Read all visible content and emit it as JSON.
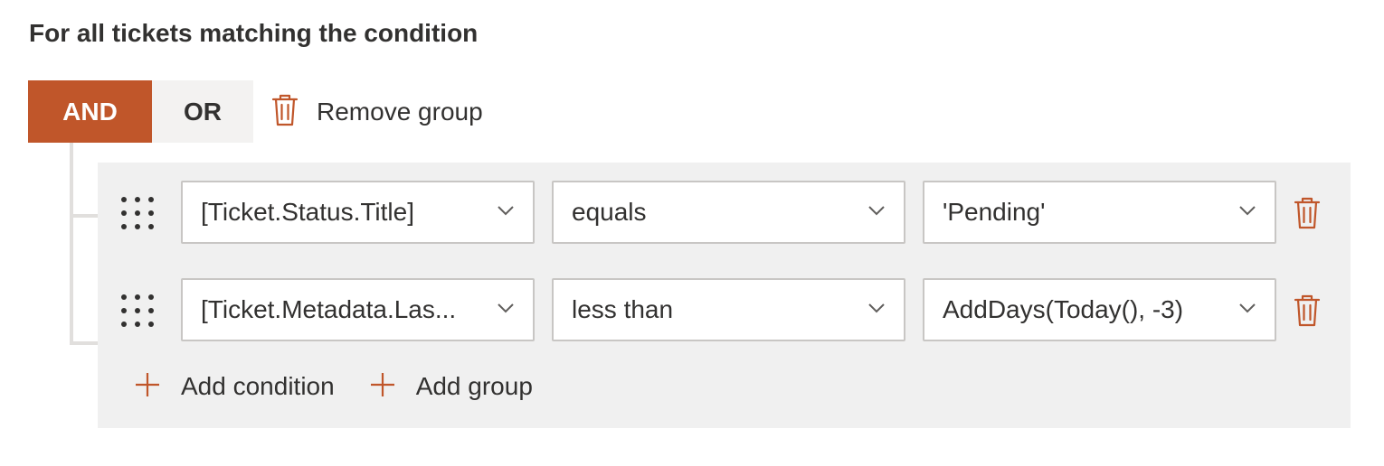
{
  "heading": "For all tickets matching the condition",
  "toggle": {
    "and_label": "AND",
    "or_label": "OR",
    "selected": "AND"
  },
  "remove_group_label": "Remove group",
  "conditions": [
    {
      "field": "[Ticket.Status.Title]",
      "operator": "equals",
      "value": "'Pending'"
    },
    {
      "field": "[Ticket.Metadata.Las...",
      "operator": "less than",
      "value": "AddDays(Today(), -3)"
    }
  ],
  "add_condition_label": "Add condition",
  "add_group_label": "Add group",
  "icons": {
    "trash": "trash-icon",
    "drag": "drag-handle-icon",
    "chevron": "chevron-down-icon",
    "plus": "plus-icon"
  },
  "colors": {
    "accent": "#c0562a",
    "toggle_bg": "#f3f2f1",
    "panel_bg": "#f0f0f0",
    "border": "#c8c6c4",
    "text": "#323130"
  }
}
